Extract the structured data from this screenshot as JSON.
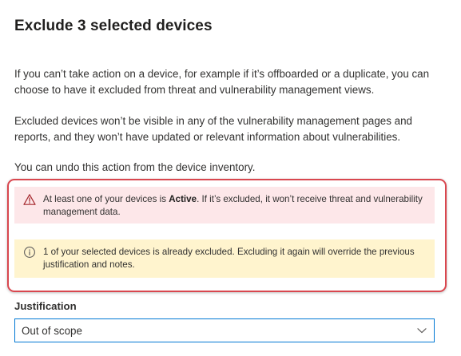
{
  "panel": {
    "title": "Exclude 3 selected devices",
    "paragraphs": [
      "If you can’t take action on a device, for example if it’s offboarded or a duplicate, you can choose to have it excluded from threat and vulnerability management views.",
      "Excluded devices won’t be visible in any of the vulnerability management pages and reports, and they won’t have updated or relevant information about vulnerabilities.",
      "You can undo this action from the device inventory."
    ]
  },
  "warning": {
    "icon": "warning-triangle-icon",
    "text_before": "At least one of your devices is ",
    "bold": "Active",
    "text_after": ". If it’s excluded, it won’t receive threat and vulnerability management data.",
    "background": "#fde7e9",
    "icon_color": "#a4262c"
  },
  "info": {
    "icon": "info-circle-icon",
    "text": "1 of your selected devices is already excluded. Excluding it again will override the previous justification and notes.",
    "background": "#fff4ce",
    "icon_color": "#605e5c"
  },
  "justification": {
    "label": "Justification",
    "selected": "Out of scope",
    "border_color": "#0078d4"
  },
  "highlight": {
    "color": "#d9474f"
  }
}
